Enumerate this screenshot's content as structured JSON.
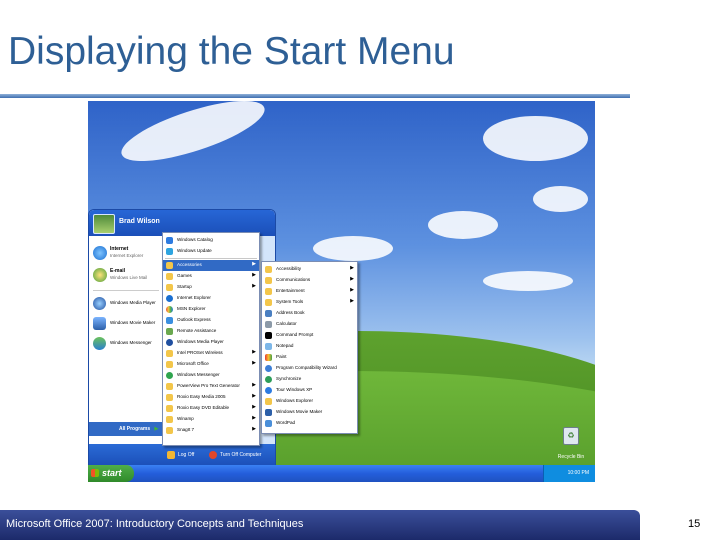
{
  "slide": {
    "title": "Displaying the Start Menu",
    "footer": "Microsoft Office 2007: Introductory Concepts and Techniques",
    "page": "15"
  },
  "colors": {
    "title": "#2e5f95",
    "highlight": "#316ac5",
    "taskbar": "#245edb",
    "start_button": "#3d9a37"
  },
  "start_menu": {
    "user_name": "Brad Wilson",
    "pinned": [
      {
        "title": "Internet",
        "subtitle": "Internet Explorer",
        "icon": "internet-explorer-icon"
      },
      {
        "title": "E-mail",
        "subtitle": "Windows Live Mail",
        "icon": "email-icon"
      }
    ],
    "recent": [
      {
        "label": "Windows Media Player",
        "icon": "media-player-icon"
      },
      {
        "label": "Windows Movie Maker",
        "icon": "movie-maker-icon"
      },
      {
        "label": "Windows Messenger",
        "icon": "messenger-icon"
      }
    ],
    "all_programs": "All Programs",
    "log_off": "Log Off",
    "turn_off": "Turn Off Computer"
  },
  "programs_menu": [
    {
      "label": "Windows Catalog",
      "arrow": false
    },
    {
      "label": "Windows Update",
      "arrow": false
    },
    {
      "label": "Accessories",
      "arrow": true,
      "highlighted": true
    },
    {
      "label": "Games",
      "arrow": true
    },
    {
      "label": "Startup",
      "arrow": true
    },
    {
      "label": "Internet Explorer",
      "arrow": false
    },
    {
      "label": "MSN Explorer",
      "arrow": false
    },
    {
      "label": "Outlook Express",
      "arrow": false
    },
    {
      "label": "Remote Assistance",
      "arrow": false
    },
    {
      "label": "Windows Media Player",
      "arrow": false
    },
    {
      "label": "Intel PROSet Wireless",
      "arrow": true
    },
    {
      "label": "Microsoft Office",
      "arrow": true
    },
    {
      "label": "Windows Messenger",
      "arrow": false
    },
    {
      "label": "PowerView Pro Text Generator",
      "arrow": true
    },
    {
      "label": "Roxio Easy Media 2005",
      "arrow": true
    },
    {
      "label": "Roxio Easy DVD Editable",
      "arrow": true
    },
    {
      "label": "Winamp",
      "arrow": true
    },
    {
      "label": "SnagIt 7",
      "arrow": true
    }
  ],
  "accessories_menu": [
    {
      "label": "Accessibility",
      "arrow": true
    },
    {
      "label": "Communications",
      "arrow": true
    },
    {
      "label": "Entertainment",
      "arrow": true
    },
    {
      "label": "System Tools",
      "arrow": true
    },
    {
      "label": "Address Book",
      "arrow": false
    },
    {
      "label": "Calculator",
      "arrow": false
    },
    {
      "label": "Command Prompt",
      "arrow": false
    },
    {
      "label": "Notepad",
      "arrow": false
    },
    {
      "label": "Paint",
      "arrow": false
    },
    {
      "label": "Program Compatibility Wizard",
      "arrow": false
    },
    {
      "label": "Synchronize",
      "arrow": false
    },
    {
      "label": "Tour Windows XP",
      "arrow": false
    },
    {
      "label": "Windows Explorer",
      "arrow": false
    },
    {
      "label": "Windows Movie Maker",
      "arrow": false
    },
    {
      "label": "WordPad",
      "arrow": false
    }
  ],
  "desktop": {
    "recycle_bin": "Recycle Bin"
  },
  "taskbar": {
    "start_label": "start",
    "clock": "10:00 PM"
  }
}
